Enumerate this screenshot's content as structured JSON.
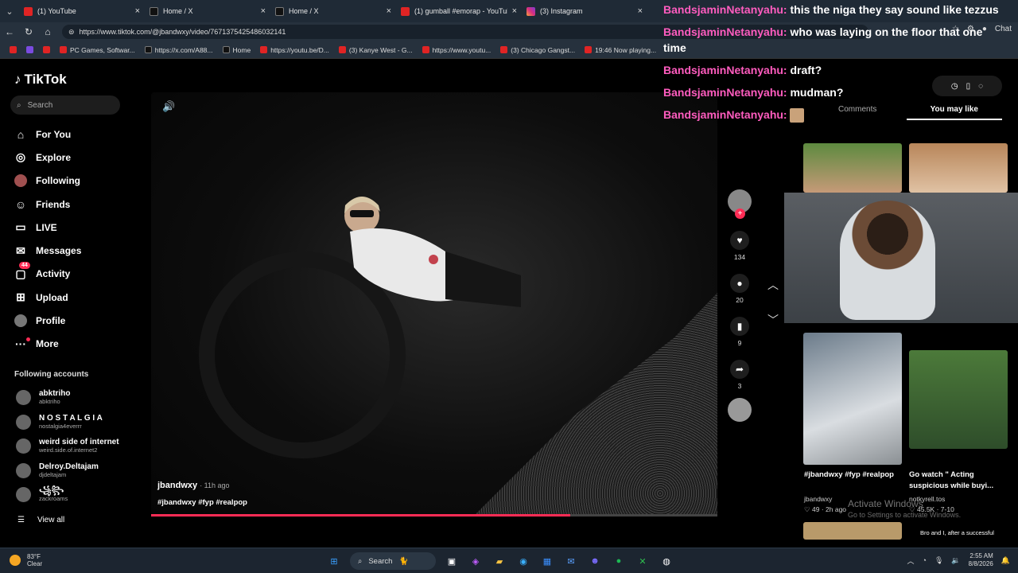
{
  "browser": {
    "tabs": [
      {
        "title": "(1) YouTube",
        "color": "#e02424"
      },
      {
        "title": "Home / X",
        "color": "#111111"
      },
      {
        "title": "Home / X",
        "color": "#111111"
      },
      {
        "title": "(1) gumball #emorap - YouTube",
        "color": "#e02424"
      },
      {
        "title": "(3) Instagram",
        "color": "#d92e7f"
      }
    ],
    "url": "https://www.tiktok.com/@jbandwxy/video/7671375425486032141",
    "chat_button": "Chat",
    "bookmarks": [
      "PC Games, Softwar...",
      "https://x.com/A88...",
      "Home",
      "https://youtu.be/D...",
      "(3) Kanye West - G...",
      "https://www.youtu...",
      "(3) Chicago Gangst...",
      "19:46 Now playing..."
    ]
  },
  "tiktok": {
    "logo": "TikTok",
    "search_placeholder": "Search",
    "menu": [
      {
        "label": "For You",
        "icon": "home-icon"
      },
      {
        "label": "Explore",
        "icon": "compass-icon"
      },
      {
        "label": "Following",
        "icon": "following-avatar-icon"
      },
      {
        "label": "Friends",
        "icon": "friends-icon"
      },
      {
        "label": "LIVE",
        "icon": "live-icon"
      },
      {
        "label": "Messages",
        "icon": "messages-icon"
      },
      {
        "label": "Activity",
        "icon": "activity-icon",
        "badge": "44"
      },
      {
        "label": "Upload",
        "icon": "upload-icon"
      },
      {
        "label": "Profile",
        "icon": "profile-icon"
      },
      {
        "label": "More",
        "icon": "more-icon"
      }
    ],
    "following_title": "Following accounts",
    "accounts": [
      {
        "name": "abktriho",
        "handle": "abktriho"
      },
      {
        "name": "N O S T A L G I A",
        "handle": "nostalgia4everrr"
      },
      {
        "name": "weird side of internet",
        "handle": "weird.side.of.internet2"
      },
      {
        "name": "Delroy.Deltajam",
        "handle": "djdeltajam"
      },
      {
        "name": "꧁꧂",
        "handle": "zackroams"
      }
    ],
    "view_all": "View all",
    "video": {
      "author": "jbandwxy",
      "time_ago": "· 11h ago",
      "tags": "#jbandwxy #fyp #realpop",
      "progress": 0.74
    },
    "actions": {
      "likes": "134",
      "comments": "20",
      "saves": "9",
      "shares": "3"
    },
    "right_panel": {
      "tab_comments": "Comments",
      "tab_you_may_like": "You may like",
      "cards": [
        {
          "caption": "#jbandwxy #fyp #realpop",
          "author": "jbandwxy",
          "likes": "49",
          "age": "· 2h ago"
        },
        {
          "caption": "Go watch \" Acting suspicious while buyi...",
          "author": "notkyrell.tos",
          "likes": "45.5K",
          "age": "· 7-10"
        }
      ],
      "bottom_caption": "Bro and I, after a successful"
    }
  },
  "chat_overlay": [
    {
      "user": "BandsjaminNetanyahu:",
      "text": "this the niga they say sound like tezzus"
    },
    {
      "user": "BandsjaminNetanyahu:",
      "text": "who was laying on the floor that one time"
    },
    {
      "user": "BandsjaminNetanyahu:",
      "text": "draft?"
    },
    {
      "user": "BandsjaminNetanyahu:",
      "text": "mudman?"
    },
    {
      "user": "BandsjaminNetanyahu:",
      "text": ""
    }
  ],
  "watermark": {
    "line1": "Activate Windows",
    "line2": "Go to Settings to activate Windows."
  },
  "taskbar": {
    "temp": "83°F",
    "condition": "Clear",
    "search": "Search",
    "time": "2:55 AM",
    "date": "8/8/2026"
  }
}
